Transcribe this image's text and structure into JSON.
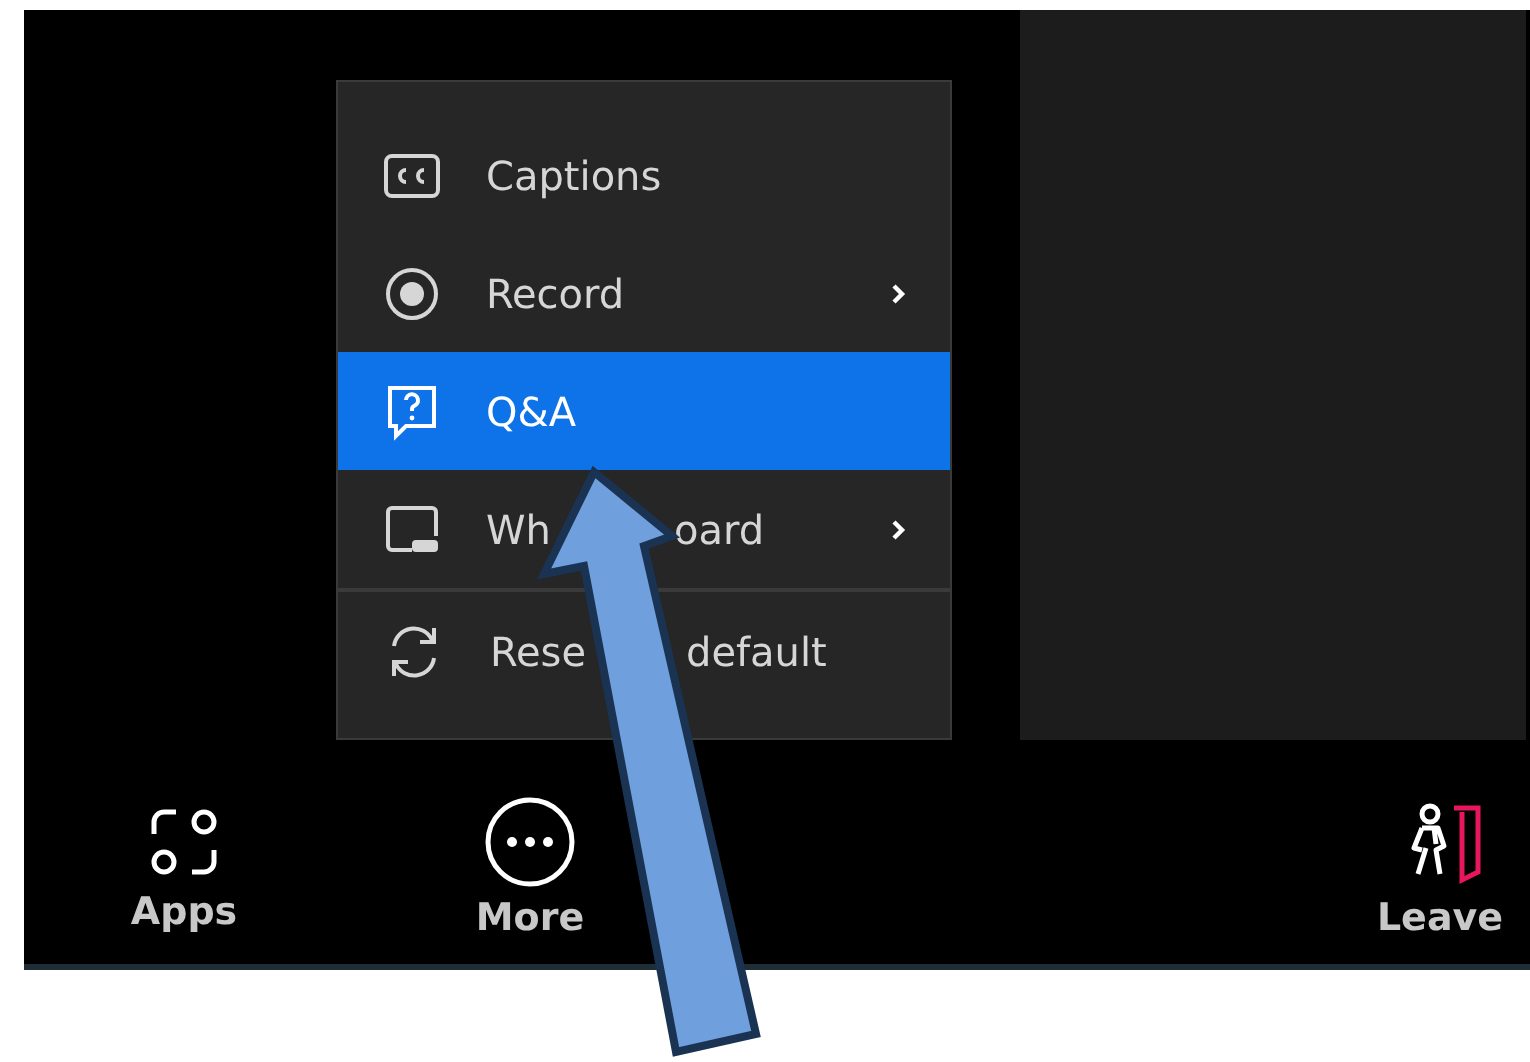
{
  "menu": {
    "items": [
      {
        "kind": "captions",
        "label_parts": [
          "Captions"
        ],
        "selected": false,
        "submenu": false,
        "separator_before": false
      },
      {
        "kind": "record",
        "label_parts": [
          "Record"
        ],
        "selected": false,
        "submenu": true,
        "separator_before": false
      },
      {
        "kind": "qa",
        "label_parts": [
          "Q&A"
        ],
        "selected": true,
        "submenu": false,
        "separator_before": false
      },
      {
        "kind": "whiteboard",
        "label_parts": [
          "Wh",
          "oard"
        ],
        "selected": false,
        "submenu": true,
        "separator_before": false
      },
      {
        "kind": "reset",
        "label_parts": [
          "Rese",
          "default"
        ],
        "selected": false,
        "submenu": false,
        "separator_before": true
      }
    ]
  },
  "toolbar": {
    "buttons": [
      {
        "kind": "apps",
        "label": "Apps"
      },
      {
        "kind": "more",
        "label": "More"
      },
      {
        "kind": "leave",
        "label": "Leave"
      }
    ]
  }
}
